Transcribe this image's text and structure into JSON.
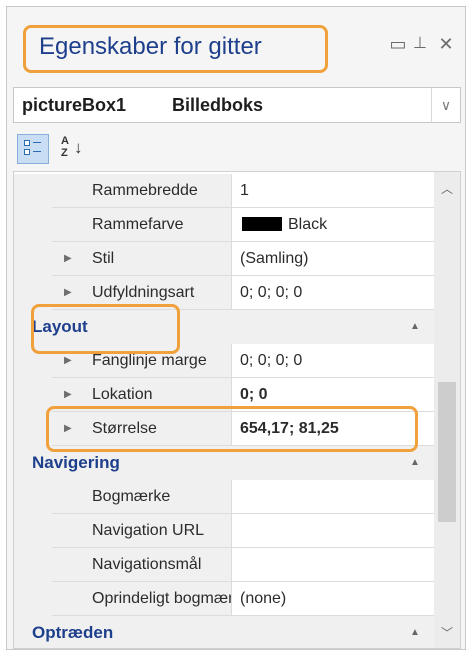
{
  "window": {
    "title": "Egenskaber for gitter",
    "icons": {
      "window": "window-position-icon",
      "pin": "pin-icon",
      "close": "close-icon"
    },
    "highlight_color": "#f0a13c"
  },
  "selector": {
    "name": "pictureBox1",
    "type": "Billedboks"
  },
  "toolbar": {
    "categorized_icon": "categorized-view-icon",
    "alphabetical_icon": "alphabetical-sort-icon",
    "alpha_glyph": "A\nZ"
  },
  "rows": [
    {
      "kind": "prop",
      "name": "Rammebredde",
      "value": "1"
    },
    {
      "kind": "prop",
      "name": "Rammefarve",
      "value": "Black",
      "swatch": "#000000"
    },
    {
      "kind": "prop",
      "name": "Stil",
      "value": "(Samling)",
      "expandable": true
    },
    {
      "kind": "prop",
      "name": "Udfyldningsart",
      "value": "0; 0; 0; 0",
      "expandable": true
    },
    {
      "kind": "cat",
      "label": "Layout"
    },
    {
      "kind": "prop",
      "name": "Fanglinje marge",
      "value": "0; 0; 0; 0",
      "expandable": true
    },
    {
      "kind": "prop",
      "name": "Lokation",
      "value": "0; 0",
      "expandable": true,
      "bold": true
    },
    {
      "kind": "prop",
      "name": "Størrelse",
      "value": "654,17; 81,25",
      "expandable": true,
      "bold": true
    },
    {
      "kind": "cat",
      "label": "Navigering"
    },
    {
      "kind": "prop",
      "name": "Bogmærke",
      "value": ""
    },
    {
      "kind": "prop",
      "name": "Navigation URL",
      "value": ""
    },
    {
      "kind": "prop",
      "name": "Navigationsmål",
      "value": ""
    },
    {
      "kind": "prop",
      "name": "Oprindeligt bogmærke",
      "value": "(none)"
    },
    {
      "kind": "cat",
      "label": "Optræden"
    }
  ]
}
